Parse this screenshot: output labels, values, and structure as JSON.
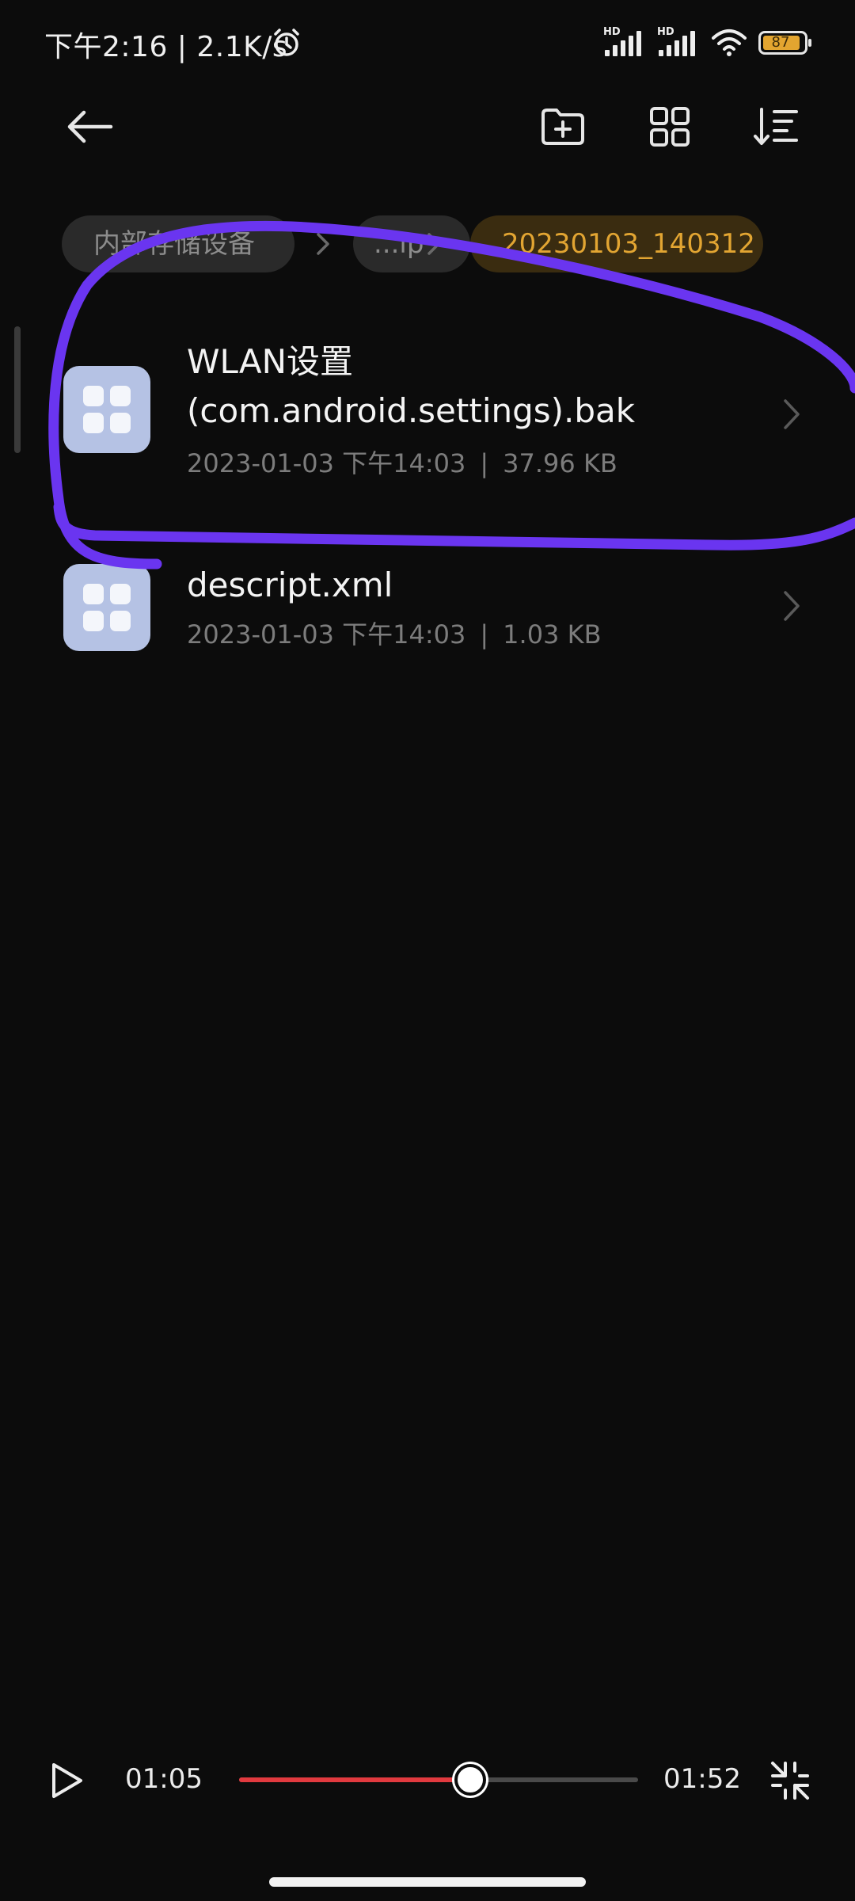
{
  "status_bar": {
    "time": "下午2:16 | 2.1K/s",
    "signal_1_label": "HD",
    "signal_2_label": "HD",
    "battery_level": "87",
    "icons": [
      "alarm-icon",
      "signal-icon",
      "signal-icon",
      "wifi-icon",
      "battery-icon"
    ]
  },
  "toolbar": {
    "icons": [
      "back-arrow-icon",
      "new-folder-icon",
      "grid-view-icon",
      "sort-icon"
    ]
  },
  "breadcrumb": {
    "items": [
      {
        "label": "内部存储设备"
      },
      {
        "label": "...lp"
      },
      {
        "label": "20230103_140312"
      }
    ]
  },
  "files": [
    {
      "name_line1": "WLAN设置",
      "name_line2": "(com.android.settings).bak",
      "date": "2023-01-03 下午14:03",
      "size": "37.96 KB"
    },
    {
      "name_line1": "descript.xml",
      "date": "2023-01-03 下午14:03",
      "size": "1.03 KB"
    }
  ],
  "meta_separator": "|",
  "player": {
    "current_time": "01:05",
    "total_time": "01:52",
    "progress": 0.58
  },
  "colors": {
    "background": "#0c0c0c",
    "accent_breadcrumb": "#e2a532",
    "progress": "#e23a3f",
    "annotation_stroke": "#6a35f0",
    "file_icon": "#b5c2e4"
  }
}
